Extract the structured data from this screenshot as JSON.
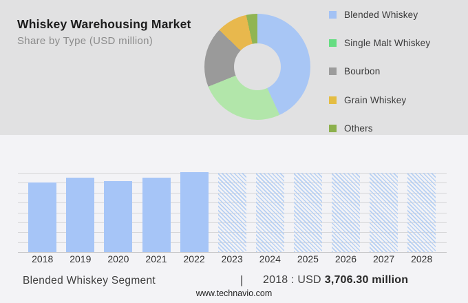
{
  "header": {
    "title": "Whiskey Warehousing Market",
    "subtitle": "Share by Type (USD million)"
  },
  "colors": {
    "top_bg": "#e1e1e2",
    "bottom_bg": "#f3f3f6",
    "gridline": "#d6d6d8",
    "baseline": "#c6c6c8",
    "bar_blue": "#a6c5f7",
    "hatch_blue": "#b7d0f3",
    "title_text": "#1c1c1c",
    "subtitle_text": "#8b8b8b",
    "legend_text": "#3a3a3a",
    "label_text": "#323232",
    "footer_text": "#3f3f3f",
    "footer_bold": "#282828",
    "website_text": "#1f1f1f"
  },
  "chart_data": [
    {
      "type": "pie",
      "donut": true,
      "title": "Share by Type (USD million)",
      "labels": [
        "Blended Whiskey",
        "Single Malt Whiskey",
        "Bourbon",
        "Grain Whiskey",
        "Others"
      ],
      "values_pct": [
        43.1,
        25.8,
        18.3,
        9.4,
        3.4
      ],
      "slice_colors": [
        "#a8c6f5",
        "#b2e6aa",
        "#9a9a9a",
        "#e8b84d",
        "#90b553"
      ],
      "legend_colors": [
        "#a3c2f5",
        "#66dd82",
        "#9c9c9c",
        "#e4bd43",
        "#8cb04c"
      ],
      "start_angle_deg": 0,
      "direction": "clockwise",
      "legend_position": "right"
    },
    {
      "type": "bar",
      "categories": [
        "2018",
        "2019",
        "2020",
        "2021",
        "2022",
        "2023",
        "2024",
        "2025",
        "2026",
        "2027",
        "2028"
      ],
      "series": [
        {
          "name": "Blended Whiskey",
          "heights_pct_of_plot": [
            88.2,
            94.3,
            89.6,
            94.1,
            101.2,
            null,
            null,
            null,
            null,
            null,
            null
          ]
        }
      ],
      "forecast_categories": [
        "2023",
        "2024",
        "2025",
        "2026",
        "2027",
        "2028"
      ],
      "forecast_style": "hatched_full_height",
      "known_point": {
        "year": "2018",
        "value": "USD 3,706.30 million"
      },
      "gridline_count": 9,
      "grid": true,
      "xlabel": "",
      "ylabel": "",
      "legend_position": "none"
    }
  ],
  "footer": {
    "segment_label": "Blended Whiskey Segment",
    "separator": "|",
    "value_prefix": "2018 : USD",
    "value_bold": "3,706.30 million",
    "website": "www.technavio.com"
  }
}
